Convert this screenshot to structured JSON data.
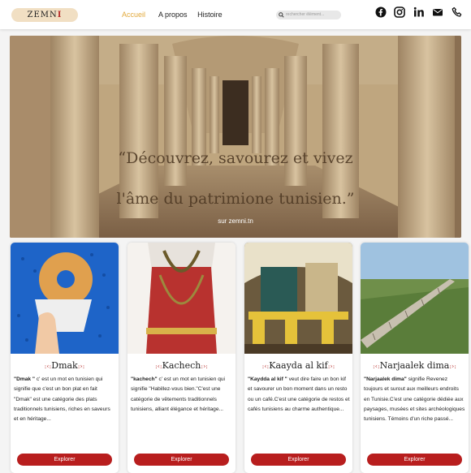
{
  "nav": {
    "logo_text": "ZEMNI",
    "links": [
      "Accueil",
      "A propos",
      "Histoire"
    ],
    "search_placeholder": "rechercher élément...",
    "socials": [
      "facebook-icon",
      "instagram-icon",
      "linkedin-icon",
      "mail-icon",
      "phone-icon"
    ],
    "accent_color": "#e2a93b"
  },
  "hero": {
    "line1": "“Découvrez, savourez et vivez",
    "line2": "l'âme du patrimione tunisien.”",
    "sub": "sur zemni.tn"
  },
  "cards": [
    {
      "title": "Dmak",
      "lead": "\"Dmak \"",
      "text": " c' est un mot en tunisien qui signifie que c'est un bon plat en fait \"Dmak\" est une catégorie des plats traditionnels tunisiens, riches en saveurs et en héritage...",
      "button": "Explorer"
    },
    {
      "title": "Kachech",
      "lead": "\"kachech\"",
      "text": " c' est un mot en tunisien qui signifie \"Habillez-vous bien.\"C'est une catégorie de vêtements traditionnels tunisiens, alliant élégance et héritage...",
      "button": "Explorer"
    },
    {
      "title": "Kaayda al kif",
      "lead": "\"Kaydda al kif \"",
      "text": " veut dire faire un bon kif et savourer un bon moment dans un resto ou un café.C'est une catégorie de restos et cafés tunisiens au charme authentique...",
      "button": "Explorer"
    },
    {
      "title": "Narjaalek dima",
      "lead": "\"Narjaalek dima\"",
      "text": " signifie Revenez toujours et surout aux meilleurs endroits en Tunisie.C'est une catégorie dédiée aux paysages, musées et sites archéologiques tunisiens. Témoins d'un riche passé...",
      "button": "Explorer"
    }
  ],
  "colors": {
    "button": "#b81e1e",
    "logo_bg": "#f1dfc3"
  }
}
